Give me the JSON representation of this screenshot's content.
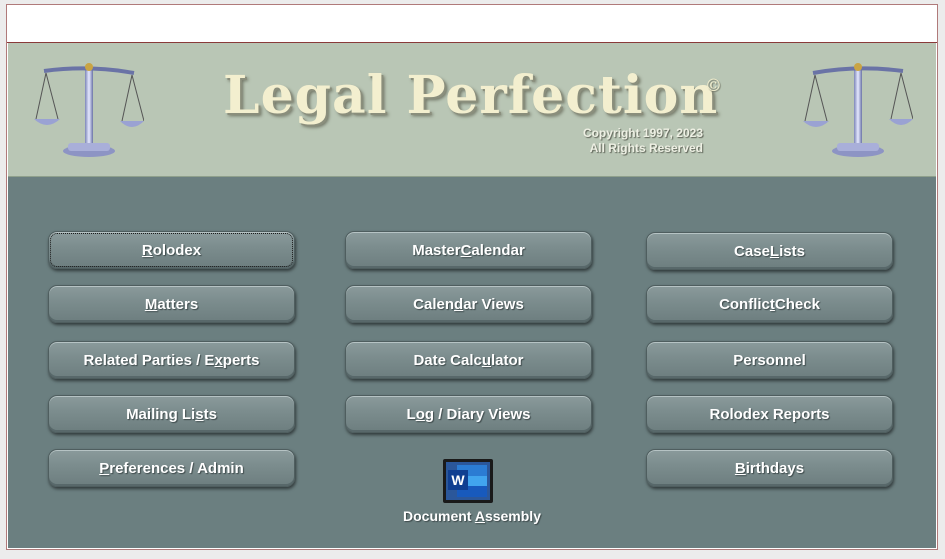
{
  "header": {
    "title": "Legal Perfection",
    "registered_mark": "©",
    "copyright_line1": "Copyright 1997, 2023",
    "copyright_line2": "All Rights Reserved",
    "left_icon": "scales-of-justice-icon",
    "right_icon": "scales-of-justice-icon"
  },
  "buttons": {
    "rolodex": {
      "pre": "",
      "u": "R",
      "post": "olodex"
    },
    "master_calendar": {
      "pre": "Master ",
      "u": "C",
      "post": "alendar"
    },
    "case_lists": {
      "pre": "Case ",
      "u": "L",
      "post": "ists"
    },
    "matters": {
      "pre": "",
      "u": "M",
      "post": "atters"
    },
    "calendar_views": {
      "pre": "Calen",
      "u": "d",
      "post": "ar Views"
    },
    "conflict_check": {
      "pre": "Conflic",
      "u": "t",
      "post": " Check"
    },
    "related_parties": {
      "pre": "Related Parties / E",
      "u": "x",
      "post": "perts"
    },
    "date_calculator": {
      "pre": "Date Calc",
      "u": "u",
      "post": "lator"
    },
    "personnel": {
      "pre": "Personnel",
      "u": "",
      "post": ""
    },
    "mailing_lists": {
      "pre": "Mailing Li",
      "u": "s",
      "post": "ts"
    },
    "log_diary_views": {
      "pre": "L",
      "u": "o",
      "post": "g / Diary Views"
    },
    "rolodex_reports": {
      "pre": "Rolodex Reports",
      "u": "",
      "post": ""
    },
    "preferences_admin": {
      "pre": "",
      "u": "P",
      "post": "references / Admin"
    },
    "birthdays": {
      "pre": "",
      "u": "B",
      "post": "irthdays"
    }
  },
  "document_assembly": {
    "icon": "microsoft-word-icon",
    "pre": "Document ",
    "u": "A",
    "post": "ssembly"
  },
  "colors": {
    "header_bg": "#b9c6b5",
    "main_bg": "#6b7f80",
    "button_face": "#7b8c8d",
    "logo_text": "#f3efcf"
  }
}
